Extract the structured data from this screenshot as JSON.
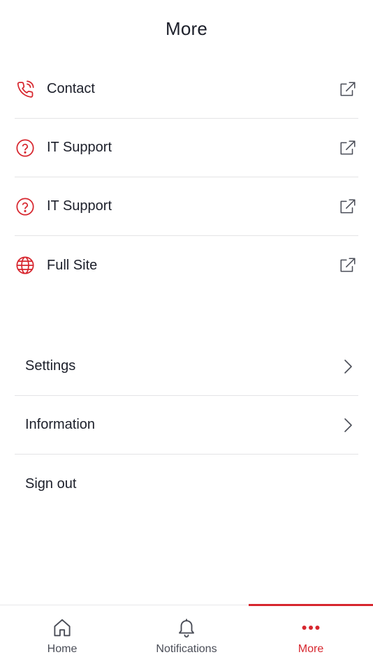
{
  "header": {
    "title": "More"
  },
  "links": [
    {
      "label": "Contact",
      "icon": "phone-icon"
    },
    {
      "label": "IT Support",
      "icon": "help-circle-icon"
    },
    {
      "label": "IT Support",
      "icon": "help-circle-icon"
    },
    {
      "label": "Full Site",
      "icon": "globe-icon"
    }
  ],
  "menu": [
    {
      "label": "Settings",
      "icon": "chevron-right-icon"
    },
    {
      "label": "Information",
      "icon": "chevron-right-icon"
    },
    {
      "label": "Sign out"
    }
  ],
  "tabbar": {
    "tabs": [
      {
        "label": "Home",
        "icon": "home-icon"
      },
      {
        "label": "Notifications",
        "icon": "bell-icon"
      },
      {
        "label": "More",
        "icon": "more-dots-icon",
        "active": true
      }
    ]
  },
  "colors": {
    "accent": "#d7262e",
    "text": "#1c1f2a",
    "divider": "#e4e4e6"
  }
}
